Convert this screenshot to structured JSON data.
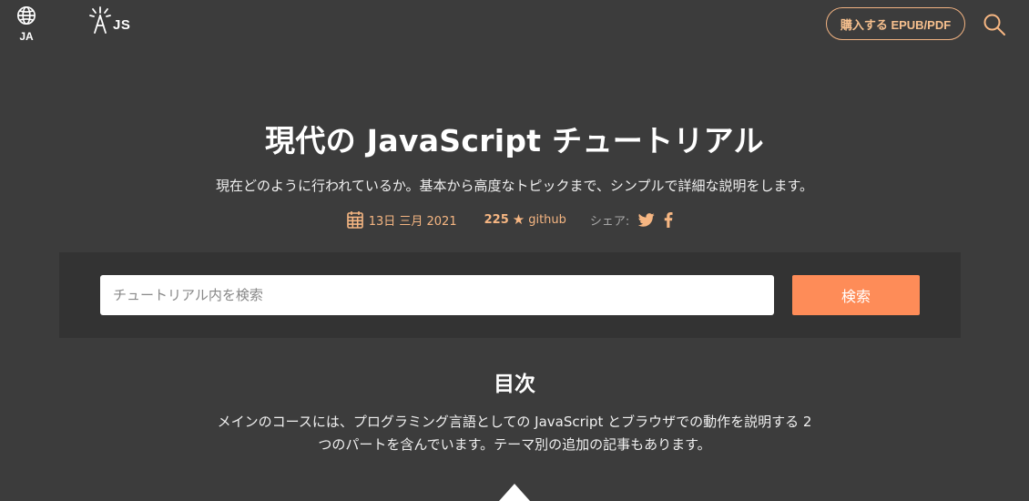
{
  "header": {
    "lang_code": "JA",
    "logo_text": "JS",
    "buy_label": "購入する EPUB/PDF",
    "icons": {
      "language": "globe-icon",
      "logo": "tower-icon",
      "search": "search-icon"
    }
  },
  "hero": {
    "title": "現代の JavaScript チュートリアル",
    "subtitle": "現在どのように行われているか。基本から高度なトピックまで、シンプルで詳細な説明をします。",
    "date": "13日 三月 2021",
    "stars_count": "225",
    "stars_label": "github",
    "share_label": "シェア:",
    "share_icons": [
      "twitter-icon",
      "facebook-icon"
    ]
  },
  "search": {
    "placeholder": "チュートリアル内を検索",
    "value": "",
    "button_label": "検索"
  },
  "toc": {
    "heading": "目次",
    "description": "メインのコースには、プログラミング言語としての JavaScript とブラウザでの動作を説明する 2 つのパートを含んでいます。テーマ別の追加の記事もあります。"
  },
  "colors": {
    "background": "#3c3c3c",
    "panel": "#333333",
    "accent": "#fe8c58",
    "accent_text": "#f6b682"
  }
}
